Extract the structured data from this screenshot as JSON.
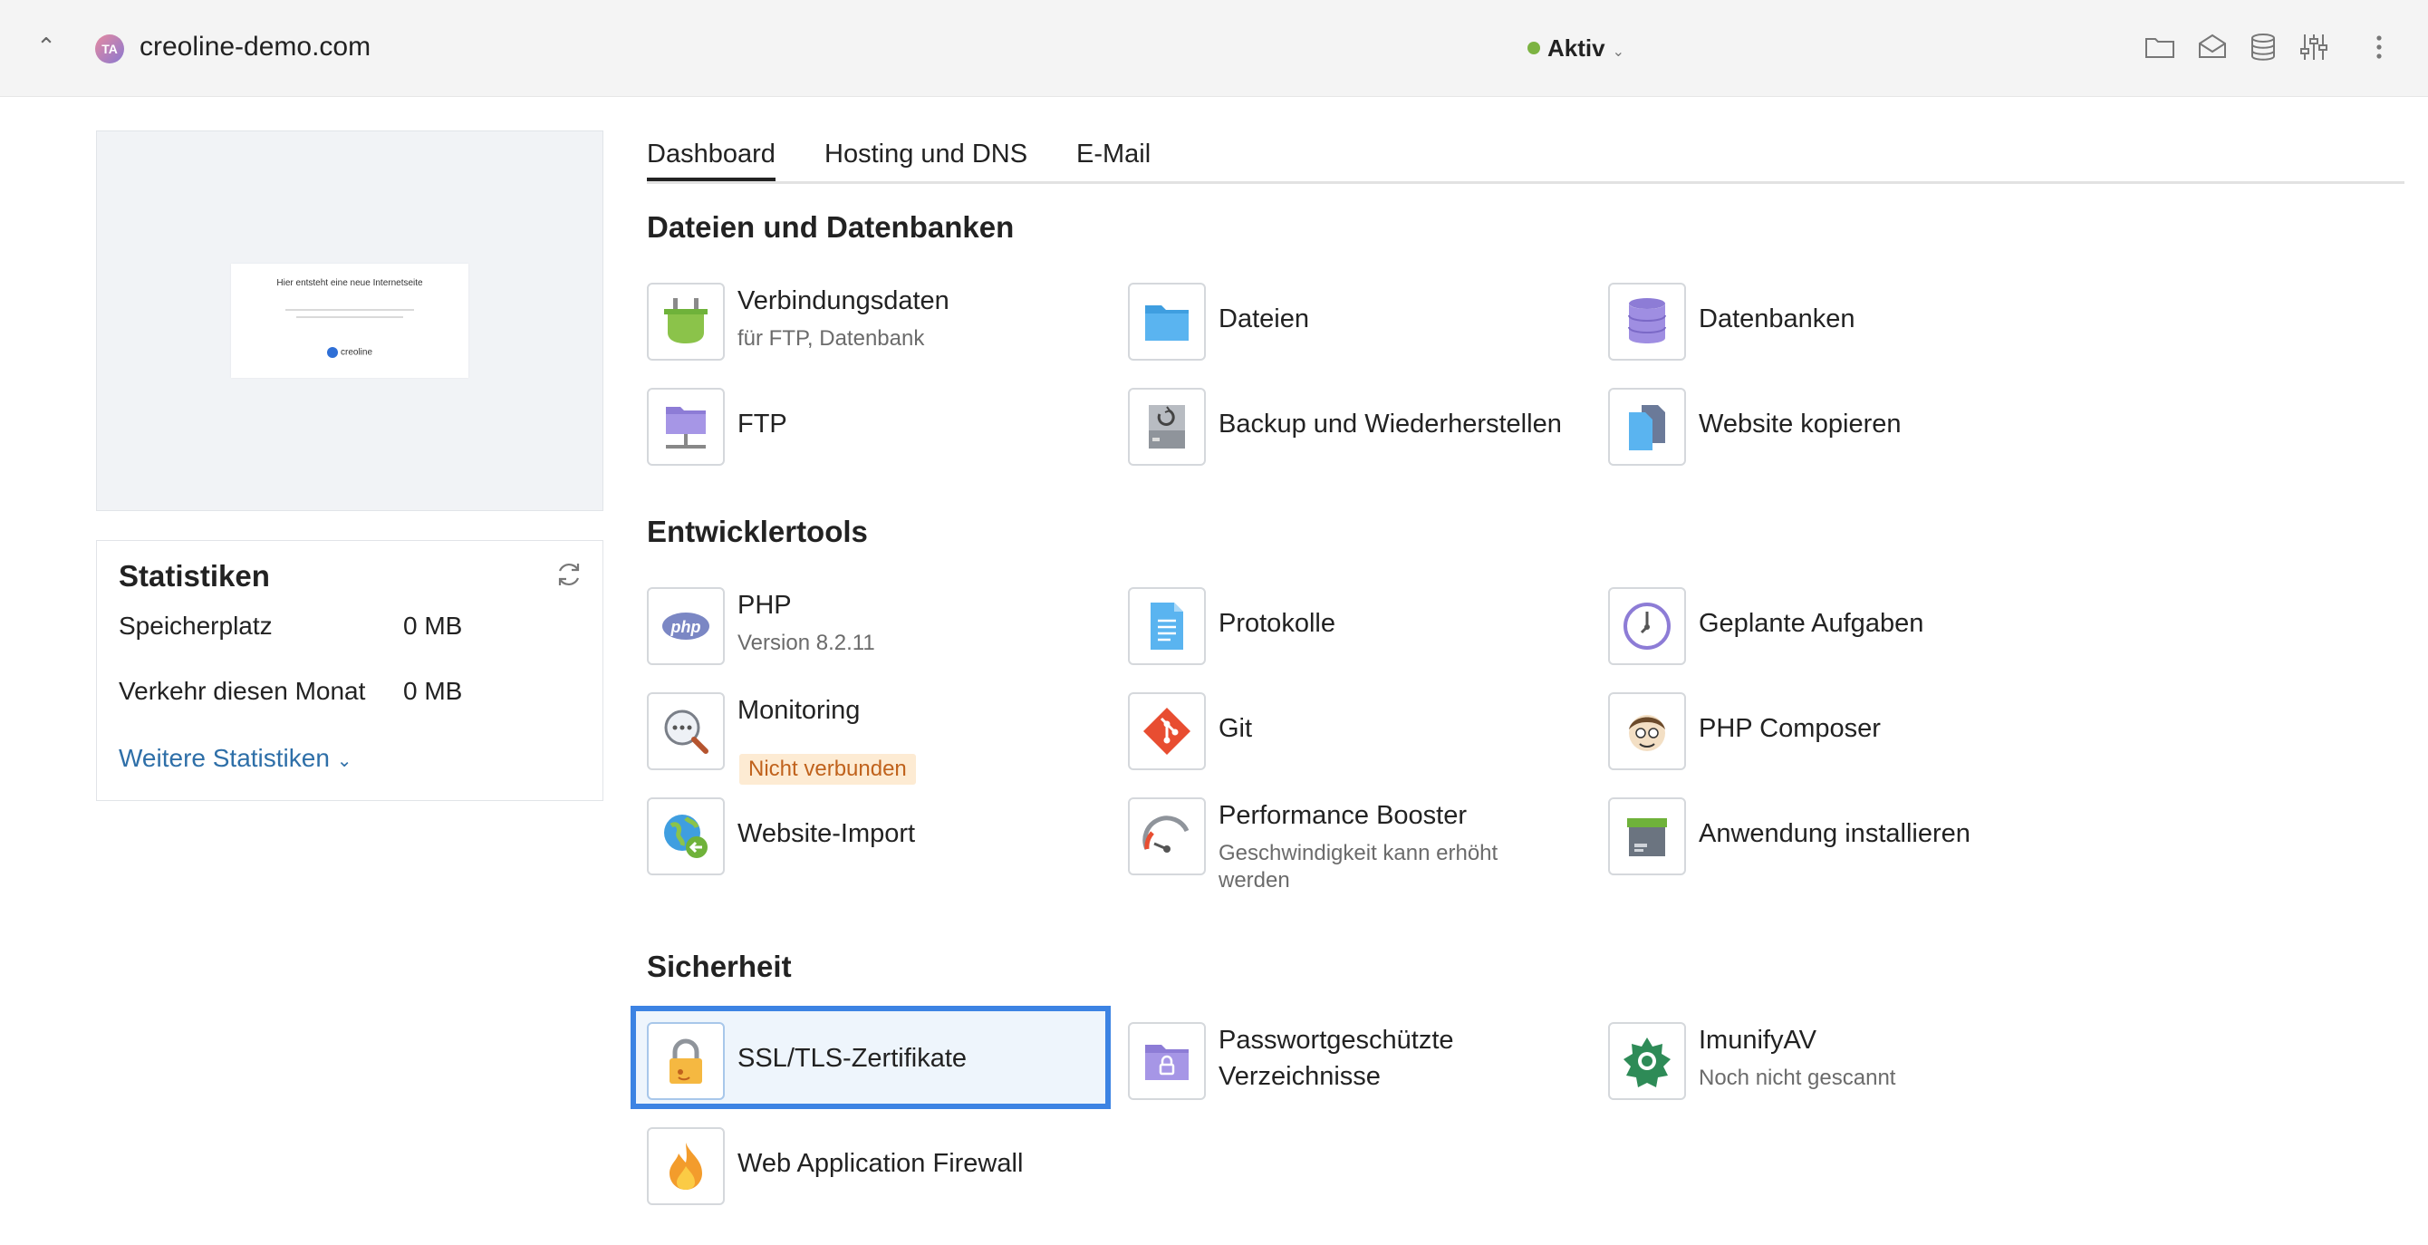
{
  "header": {
    "avatar_initials": "TA",
    "domain": "creoline-demo.com",
    "status": "Aktiv",
    "status_color": "#7cb342",
    "icons": [
      "folder-icon",
      "mail-icon",
      "database-icon",
      "sliders-icon",
      "more-vertical-icon"
    ]
  },
  "preview": {
    "title": "Hier entsteht eine neue Internetseite",
    "logo_text": "creoline"
  },
  "stats": {
    "title": "Statistiken",
    "rows": [
      {
        "label": "Speicherplatz",
        "value": "0 MB"
      },
      {
        "label": "Verkehr diesen Monat",
        "value": "0 MB"
      }
    ],
    "more_label": "Weitere Statistiken"
  },
  "tabs": [
    "Dashboard",
    "Hosting und DNS",
    "E-Mail"
  ],
  "sections": {
    "files": {
      "title": "Dateien und Datenbanken",
      "tiles": [
        {
          "label": "Verbindungsdaten",
          "sub": "für FTP, Datenbank",
          "icon": "plug-icon"
        },
        {
          "label": "Dateien",
          "icon": "folder-icon"
        },
        {
          "label": "Datenbanken",
          "icon": "database-icon"
        },
        {
          "label": "FTP",
          "icon": "ftp-folder-icon"
        },
        {
          "label": "Backup und Wiederherstellen",
          "icon": "backup-icon"
        },
        {
          "label": "Website kopieren",
          "icon": "copy-icon"
        }
      ]
    },
    "dev": {
      "title": "Entwicklertools",
      "tiles": [
        {
          "label": "PHP",
          "sub": "Version 8.2.11",
          "icon": "php-icon"
        },
        {
          "label": "Protokolle",
          "icon": "log-file-icon"
        },
        {
          "label": "Geplante Aufgaben",
          "icon": "clock-icon"
        },
        {
          "label": "Monitoring",
          "badge": "Nicht verbunden",
          "icon": "monitoring-icon"
        },
        {
          "label": "Git",
          "icon": "git-icon"
        },
        {
          "label": "PHP Composer",
          "icon": "composer-icon"
        },
        {
          "label": "Website-Import",
          "icon": "globe-import-icon"
        },
        {
          "label": "Performance Booster",
          "sub_line1": "Geschwindigkeit kann erhöht",
          "sub_line2": "werden",
          "icon": "gauge-icon"
        },
        {
          "label": "Anwendung installieren",
          "icon": "install-box-icon"
        }
      ]
    },
    "security": {
      "title": "Sicherheit",
      "tiles": [
        {
          "label": "SSL/TLS-Zertifikate",
          "icon": "lock-icon"
        },
        {
          "label_line1": "Passwortgeschützte",
          "label_line2": "Verzeichnisse",
          "icon": "locked-folder-icon"
        },
        {
          "label": "ImunifyAV",
          "sub": "Noch nicht gescannt",
          "icon": "imunify-icon"
        },
        {
          "label": "Web Application Firewall",
          "icon": "flame-icon"
        }
      ]
    }
  }
}
